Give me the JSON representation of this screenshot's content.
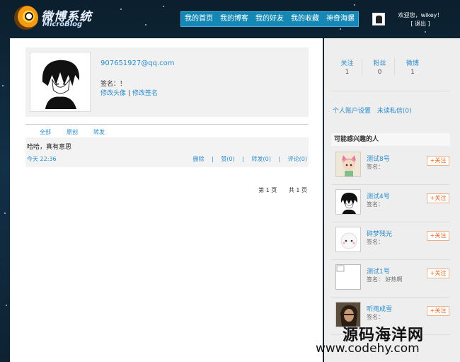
{
  "logo": {
    "cn": "微博系统",
    "en": "MicroBlog"
  },
  "nav": [
    "我的首页",
    "我的博客",
    "我的好友",
    "我的收藏",
    "神奇海螺"
  ],
  "user": {
    "welcome": "欢迎您，wikey！",
    "logout": "[ 退出 ]"
  },
  "profile": {
    "email": "907651927@qq.com",
    "signature": "签名：！",
    "edit_avatar": "修改头像",
    "divider": "|",
    "edit_signature": "修改签名"
  },
  "tabs": [
    "全部",
    "原创",
    "转发"
  ],
  "post": {
    "text": "哈哈，真有意思",
    "time": "今天 22:36",
    "actions": [
      "删除",
      "赞(0)",
      "转发(0)",
      "评论(0)"
    ]
  },
  "pager": {
    "page": "第 1 页",
    "total": "共 1 页"
  },
  "stats": [
    {
      "label": "关注",
      "value": "1"
    },
    {
      "label": "粉丝",
      "value": "0"
    },
    {
      "label": "微博",
      "value": "1"
    }
  ],
  "side_links": [
    "个人账户设置",
    "未读私信(0)"
  ],
  "recommend_title": "可能感兴趣的人",
  "recommend": [
    {
      "name": "测试8号",
      "sig": "签名：",
      "btn": "+关注"
    },
    {
      "name": "测试4号",
      "sig": "签名：",
      "btn": "+关注"
    },
    {
      "name": "碎梦残光",
      "sig": "签名：",
      "btn": "+关注"
    },
    {
      "name": "测试1号",
      "sig": "签名： 好热啊",
      "btn": "+关注"
    },
    {
      "name": "听雨成雪",
      "sig": "签名：",
      "btn": "+关注"
    }
  ],
  "watermark": {
    "cn": "源码海洋网",
    "en": "www.codehy.com"
  },
  "colors": {
    "link": "#2c8ccd",
    "nav_bg": "#1487b4",
    "follow": "#e5641b",
    "bg": "#123047"
  }
}
